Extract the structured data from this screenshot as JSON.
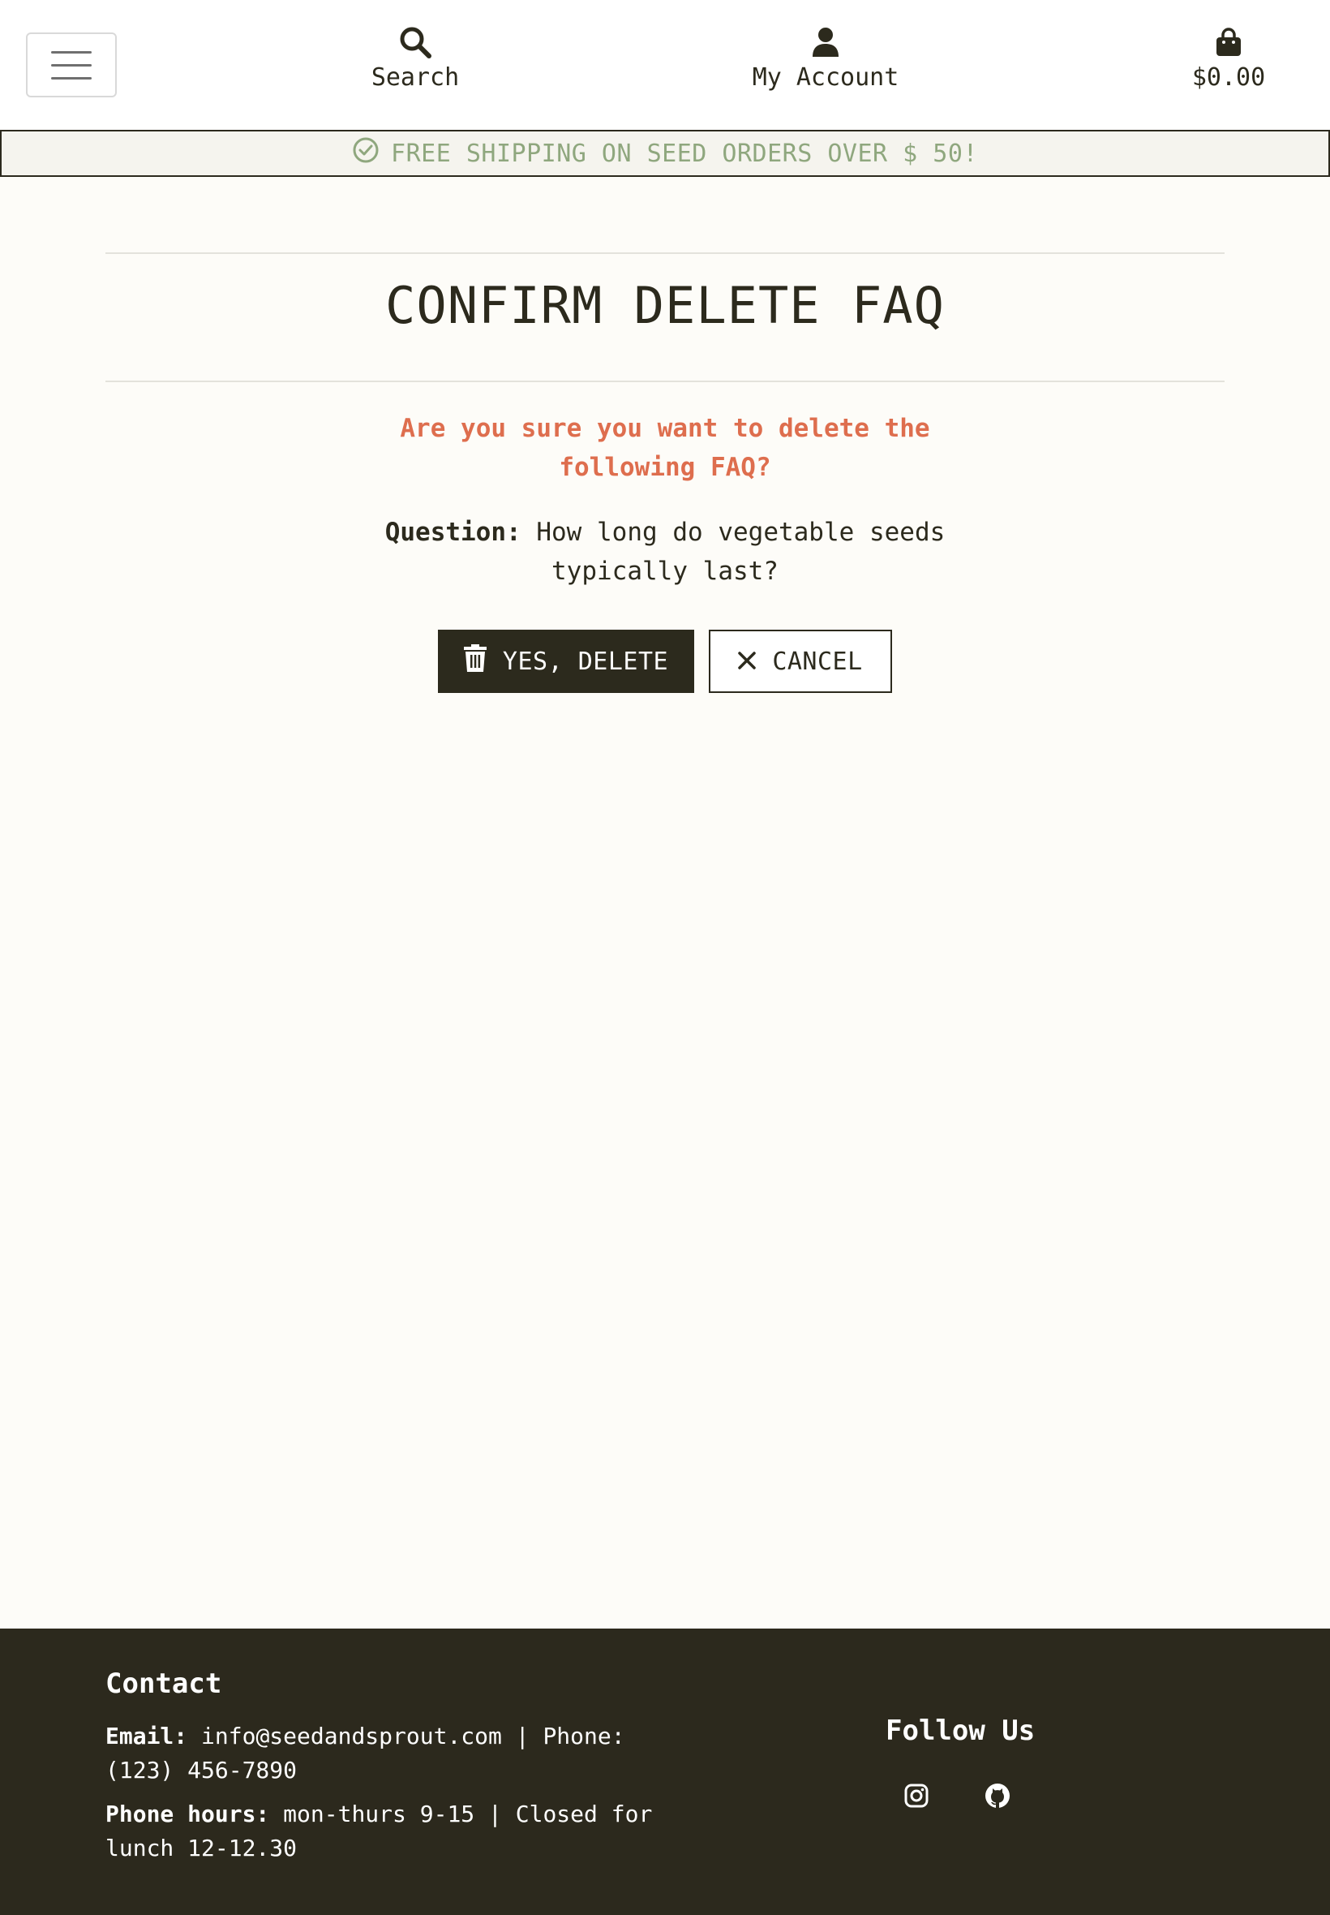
{
  "header": {
    "menu_icon": "hamburger-icon",
    "search_label": "Search",
    "search_icon": "search-icon",
    "account_label": "My Account",
    "account_icon": "user-icon",
    "cart_total": "$0.00",
    "cart_icon": "shopping-bag-icon"
  },
  "banner": {
    "icon": "check-circle-icon",
    "text": "FREE SHIPPING ON SEED ORDERS OVER $ 50!"
  },
  "main": {
    "title": "CONFIRM DELETE FAQ",
    "warning": "Are you sure you want to delete the following FAQ?",
    "question_label": "Question:",
    "question_text": "How long do vegetable seeds typically last?",
    "delete_button": "YES, DELETE",
    "cancel_button": "CANCEL"
  },
  "footer": {
    "contact_heading": "Contact",
    "email_label": "Email:",
    "email_value": "info@seedandsprout.com | Phone: (123) 456-7890",
    "hours_label": "Phone hours:",
    "hours_value": "mon-thurs 9-15 | Closed for lunch 12-12.30",
    "follow_heading": "Follow Us",
    "social_icons": [
      "instagram-icon",
      "github-icon"
    ]
  },
  "colors": {
    "dark": "#2c2a1d",
    "banner_text": "#8fa77e",
    "warning": "#de6e4e",
    "background": "#fdfcf8"
  }
}
